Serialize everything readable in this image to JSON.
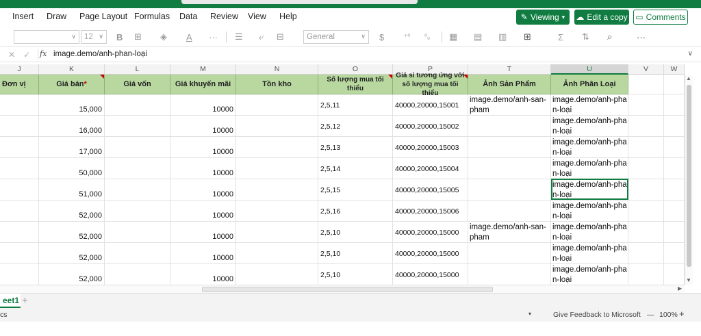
{
  "menu": [
    "Insert",
    "Draw",
    "Page Layout",
    "Formulas",
    "Data",
    "Review",
    "View",
    "Help"
  ],
  "actions": {
    "viewing": "Viewing",
    "edit_copy": "Edit a copy",
    "comments": "Comments"
  },
  "ribbon": {
    "font_size": "12",
    "number_format": "General"
  },
  "formula_bar": {
    "fx": "fx",
    "value": "image.demo/anh-phan-loại"
  },
  "columns": [
    "J",
    "K",
    "L",
    "M",
    "N",
    "O",
    "P",
    "T",
    "U",
    "V",
    "W"
  ],
  "header_row": {
    "j": "Đơn vị",
    "k": "Giá bán",
    "k_required": "*",
    "l": "Giá vốn",
    "m": "Giá khuyến mãi",
    "n": "Tồn kho",
    "o": "Số lượng mua tối thiểu",
    "p": "Giá sỉ tương ứng với số lượng mua tối thiểu",
    "t": "Ảnh Sản Phẩm",
    "u": "Ảnh Phân Loại"
  },
  "rows": [
    {
      "k": "15,000",
      "m": "10000",
      "o": "2,5,11",
      "p": "40000,20000,15001",
      "t": "image.demo/anh-san-pham",
      "u": "image.demo/anh-phan-loại"
    },
    {
      "k": "16,000",
      "m": "10000",
      "o": "2,5,12",
      "p": "40000,20000,15002",
      "t": "",
      "u": "image.demo/anh-phan-loại"
    },
    {
      "k": "17,000",
      "m": "10000",
      "o": "2,5,13",
      "p": "40000,20000,15003",
      "t": "",
      "u": "image.demo/anh-phan-loại"
    },
    {
      "k": "50,000",
      "m": "10000",
      "o": "2,5,14",
      "p": "40000,20000,15004",
      "t": "",
      "u": "image.demo/anh-phan-loại"
    },
    {
      "k": "51,000",
      "m": "10000",
      "o": "2,5,15",
      "p": "40000,20000,15005",
      "t": "",
      "u": "image.demo/anh-phan-loại"
    },
    {
      "k": "52,000",
      "m": "10000",
      "o": "2,5,16",
      "p": "40000,20000,15006",
      "t": "",
      "u": "image.demo/anh-phan-loại"
    },
    {
      "k": "52,000",
      "m": "10000",
      "o": "2,5,10",
      "p": "40000,20000,15000",
      "t": "image.demo/anh-san-pham",
      "u": "image.demo/anh-phan-loại"
    },
    {
      "k": "52,000",
      "m": "10000",
      "o": "2,5,10",
      "p": "40000,20000,15000",
      "t": "",
      "u": "image.demo/anh-phan-loại"
    },
    {
      "k": "52,000",
      "m": "10000",
      "o": "2,5,10",
      "p": "40000,20000,15000",
      "t": "",
      "u": "image.demo/anh-phan-loại"
    }
  ],
  "sheet_tab": "eet1",
  "status": {
    "left": "cs",
    "feedback": "Give Feedback to Microsoft",
    "zoom": "100%"
  }
}
